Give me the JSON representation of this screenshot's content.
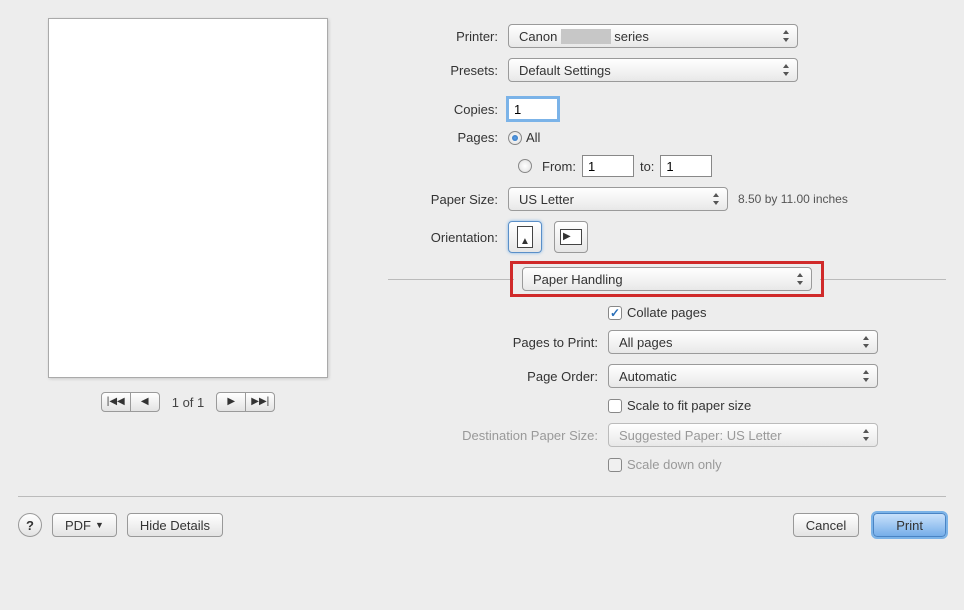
{
  "preview": {
    "page_indicator": "1 of 1"
  },
  "printer": {
    "label": "Printer:",
    "value_prefix": "Canon",
    "value_suffix": "series"
  },
  "presets": {
    "label": "Presets:",
    "value": "Default Settings"
  },
  "copies": {
    "label": "Copies:",
    "value": "1"
  },
  "pages": {
    "label": "Pages:",
    "all_label": "All",
    "from_label": "From:",
    "from_value": "1",
    "to_label": "to:",
    "to_value": "1",
    "selected": "all"
  },
  "paper_size": {
    "label": "Paper Size:",
    "value": "US Letter",
    "note": "8.50 by 11.00 inches"
  },
  "orientation": {
    "label": "Orientation:"
  },
  "section": {
    "value": "Paper Handling"
  },
  "collate": {
    "label": "Collate pages",
    "checked": true
  },
  "pages_to_print": {
    "label": "Pages to Print:",
    "value": "All pages"
  },
  "page_order": {
    "label": "Page Order:",
    "value": "Automatic"
  },
  "scale_fit": {
    "label": "Scale to fit paper size",
    "checked": false
  },
  "dest_paper": {
    "label": "Destination Paper Size:",
    "value": "Suggested Paper: US Letter"
  },
  "scale_down": {
    "label": "Scale down only",
    "checked": false
  },
  "buttons": {
    "help": "?",
    "pdf": "PDF",
    "hide_details": "Hide Details",
    "cancel": "Cancel",
    "print": "Print"
  }
}
